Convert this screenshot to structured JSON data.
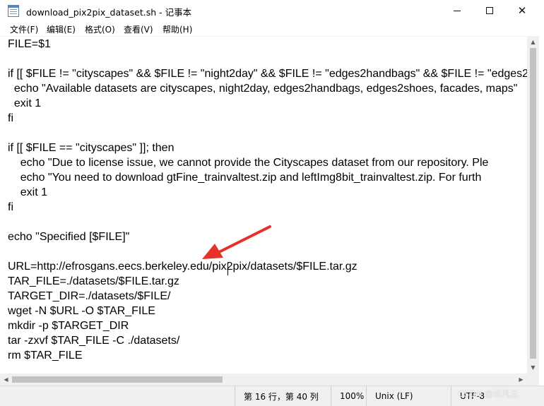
{
  "window": {
    "title": "download_pix2pix_dataset.sh - 记事本",
    "controls": {
      "minimize": "—",
      "maximize": "☐",
      "close": "✕"
    }
  },
  "menu": {
    "items": [
      {
        "label": "文件(F)"
      },
      {
        "label": "编辑(E)"
      },
      {
        "label": "格式(O)"
      },
      {
        "label": "查看(V)"
      },
      {
        "label": "帮助(H)"
      }
    ]
  },
  "editor": {
    "lines": [
      "FILE=$1",
      "",
      "if [[ $FILE != \"cityscapes\" && $FILE != \"night2day\" && $FILE != \"edges2handbags\" && $FILE != \"edges2",
      "  echo \"Available datasets are cityscapes, night2day, edges2handbags, edges2shoes, facades, maps\"",
      "  exit 1",
      "fi",
      "",
      "if [[ $FILE == \"cityscapes\" ]]; then",
      "    echo \"Due to license issue, we cannot provide the Cityscapes dataset from our repository. Ple",
      "    echo \"You need to download gtFine_trainvaltest.zip and leftImg8bit_trainvaltest.zip. For furth",
      "    exit 1",
      "fi",
      "",
      "echo \"Specified [$FILE]\"",
      "",
      "URL=http://efrosgans.eecs.berkeley.edu/pix2pix/datasets/$FILE.tar.gz",
      "TAR_FILE=./datasets/$FILE.tar.gz",
      "TARGET_DIR=./datasets/$FILE/",
      "wget -N $URL -O $TAR_FILE",
      "mkdir -p $TARGET_DIR",
      "tar -zxvf $TAR_FILE -C ./datasets/",
      "rm $TAR_FILE"
    ]
  },
  "statusbar": {
    "position": "第 16 行，第 40 列",
    "zoom": "100%",
    "line_ending": "Unix (LF)",
    "encoding": "UTF-8"
  },
  "watermark": "CSDN @末凡尘",
  "colors": {
    "annotation_arrow": "#e8302a",
    "chrome_bg": "#f0f0f0",
    "scroll_thumb": "#c2c2c2"
  }
}
